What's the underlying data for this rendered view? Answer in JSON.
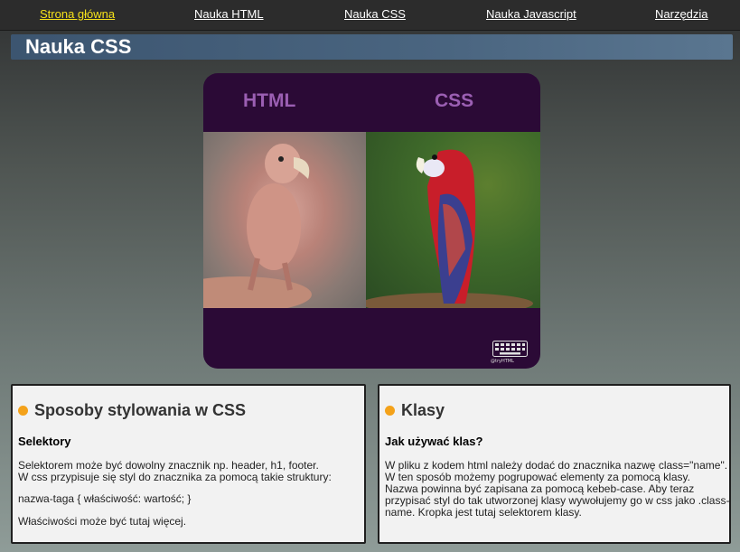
{
  "nav": {
    "items": [
      {
        "label": "Strona główna",
        "active": true
      },
      {
        "label": "Nauka HTML",
        "active": false
      },
      {
        "label": "Nauka CSS",
        "active": false
      },
      {
        "label": "Nauka Javascript",
        "active": false
      },
      {
        "label": "Narzędzia",
        "active": false
      }
    ]
  },
  "page": {
    "title": "Nauka CSS"
  },
  "hero": {
    "label_left": "HTML",
    "label_right": "CSS",
    "credit": "@tryHTML"
  },
  "cards": {
    "left": {
      "heading": "Sposoby stylowania w CSS",
      "subheading": "Selektory",
      "p1_line1": "Selektorem może być dowolny znacznik np. header, h1, footer.",
      "p1_line2": "W css przypisuje się styl do znacznika za pomocą takie struktury:",
      "p2": "nazwa-taga { właściwość: wartość; }",
      "p3": "Właściwości może być tutaj więcej."
    },
    "right": {
      "heading": "Klasy",
      "subheading": "Jak używać klas?",
      "p1_line1": "W pliku z kodem html należy dodać do znacznika nazwę class=\"name\".",
      "p1_line2": "W ten sposób możemy pogrupować elementy za pomocą klasy.",
      "p1_line3": "Nazwa powinna być zapisana za pomocą kebeb-case. Aby teraz przypisać styl do tak utworzonej klasy wywołujemy go w css jako .class-name. Kropka jest tutaj selektorem klasy."
    }
  },
  "colors": {
    "nav_active": "#f5e11a",
    "accent_dot": "#f4a21a",
    "hero_bg": "#2b0a36",
    "hero_label": "#9b5fb3",
    "title_bar": "#4a6580"
  }
}
